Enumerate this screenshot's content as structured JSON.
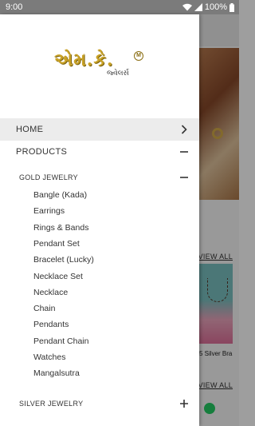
{
  "status_bar": {
    "time": "9:00",
    "battery": "100%"
  },
  "logo": {
    "mark_text": "એમ.કે.",
    "badge_text": "M",
    "sub_text": "જ્વેલર્સ"
  },
  "background": {
    "view_all_1": "VIEW ALL",
    "view_all_2": "VIEW ALL",
    "product_caption": "5 Silver Bra"
  },
  "menu": {
    "home": "HOME",
    "products": "PRODUCTS",
    "gold_jewelry": "GOLD JEWELRY",
    "gold_items": [
      "Bangle (Kada)",
      "Earrings",
      "Rings & Bands",
      "Pendant Set",
      "Bracelet (Lucky)",
      "Necklace Set",
      "Necklace",
      "Chain",
      "Pendants",
      "Pendant Chain",
      "Watches",
      "Mangalsutra"
    ],
    "silver_jewelry": "SILVER JEWELRY"
  }
}
